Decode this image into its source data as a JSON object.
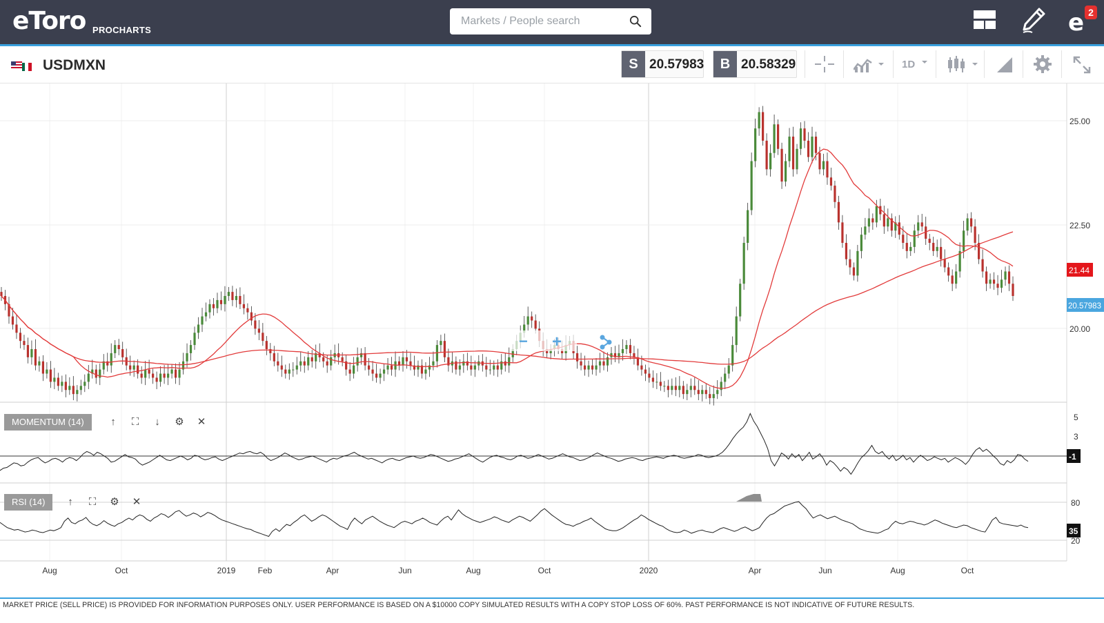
{
  "header": {
    "logo": "eToro",
    "product": "PROCHARTS",
    "search_placeholder": "Markets / People search",
    "notifications_count": "2"
  },
  "instrument": {
    "symbol": "USDMXN",
    "sell_tag": "S",
    "sell_price": "20.57983",
    "buy_tag": "B",
    "buy_price": "20.58329",
    "timeframe": "1D"
  },
  "price_axis": {
    "ticks": [
      "25.00",
      "22.50",
      "20.00"
    ],
    "ma_label": "21.44",
    "price_label": "20.57983"
  },
  "zoom_tools": {
    "zoom_out": "−",
    "zoom_in": "+"
  },
  "momentum": {
    "label": "MOMENTUM (14)",
    "ticks": [
      "5",
      "3"
    ],
    "value_label": "-1",
    "series": [
      -1.9,
      -1.6,
      -1.5,
      -1.2,
      -0.9,
      -1.0,
      -1.3,
      -1.2,
      -0.8,
      -0.5,
      -0.3,
      -0.2,
      -0.6,
      -0.9,
      -0.7,
      -0.4,
      -0.3,
      -0.5,
      -0.8,
      -0.4,
      -0.2,
      -0.3,
      -0.6,
      -0.2,
      0.3,
      0.6,
      0.4,
      0.1,
      0.5,
      0.3,
      0.0,
      -0.3,
      -0.8,
      -0.7,
      -0.4,
      -0.1,
      0.2,
      -0.1,
      -0.2,
      -0.4,
      -0.9,
      -1.2,
      -1.0,
      -0.8,
      -0.5,
      -0.2,
      0.1,
      -0.2,
      -0.5,
      -0.6,
      -0.4,
      -0.2,
      0.0,
      -0.2,
      -0.5,
      -0.3,
      0.1,
      0.0,
      -0.3,
      -0.5,
      -0.4,
      -0.2,
      -0.1,
      -0.4,
      -0.6,
      -0.4,
      -0.2,
      0.0,
      0.2,
      0.4,
      0.3,
      0.5,
      0.6,
      0.4,
      0.3,
      0.5,
      0.2,
      -0.3,
      -0.6,
      -0.4,
      -0.2,
      0.1,
      0.4,
      0.2,
      -0.1,
      -0.3,
      -0.5,
      -0.4,
      -0.2,
      -0.1,
      0.0,
      -0.2,
      -0.4,
      -0.6,
      -0.8,
      -0.5,
      -0.3,
      -0.4,
      -0.2,
      0.0,
      0.1,
      0.3,
      0.5,
      0.2,
      0.0,
      -0.2,
      -0.4,
      -0.3,
      -0.5,
      -0.7,
      -0.9,
      -0.6,
      -0.4,
      -0.3,
      -0.5,
      -0.6,
      -0.4,
      -0.2,
      -0.1,
      0.0,
      -0.2,
      -0.3,
      -0.2,
      0.0,
      0.2,
      0.1,
      -0.1,
      -0.3,
      -0.5,
      -0.7,
      -0.6,
      -0.4,
      -0.3,
      -0.1,
      0.1,
      0.3,
      0.0,
      -0.3,
      -0.6,
      -0.8,
      -0.5,
      -0.2,
      0.0,
      0.1,
      -0.1,
      -0.2,
      -0.4,
      -0.5,
      -0.3,
      0.0,
      0.1,
      -0.1,
      -0.3,
      -0.2,
      0.0,
      0.2,
      0.0,
      -0.2,
      -0.4,
      -0.3,
      -0.1,
      0.1,
      0.3,
      0.1,
      -0.1,
      -0.2,
      -0.4,
      -0.6,
      -0.5,
      -0.3,
      -0.1,
      0.2,
      0.4,
      0.2,
      0.0,
      -0.2,
      -0.3,
      -0.5,
      -0.7,
      -0.6,
      -0.4,
      -0.3,
      -0.2,
      -0.3,
      -0.5,
      -0.6,
      -0.4,
      -0.3,
      -0.2,
      -0.1,
      -0.2,
      -0.3,
      -0.1,
      0.0,
      0.1,
      0.0,
      -0.2,
      -0.3,
      -0.2,
      -0.1,
      0.0,
      0.2,
      0.1,
      -0.1,
      -0.2,
      -0.1,
      0.0,
      0.2,
      0.5,
      1.0,
      1.6,
      2.3,
      2.9,
      3.4,
      3.8,
      4.5,
      5.6,
      4.6,
      3.9,
      3.0,
      2.1,
      1.0,
      -0.6,
      -1.3,
      -0.5,
      0.4,
      0.1,
      -0.4,
      0.3,
      -0.2,
      0.2,
      -0.6,
      -0.1,
      0.5,
      -0.4,
      -0.1,
      0.3,
      -0.3,
      -1.2,
      -0.6,
      -0.9,
      -1.4,
      -2.0,
      -1.5,
      -1.8,
      -2.4,
      -1.7,
      -0.9,
      -0.2,
      0.2,
      0.7,
      1.4,
      0.6,
      0.3,
      0.6,
      0.0,
      -0.4,
      0.1,
      -0.6,
      -0.3,
      0.1,
      -0.5,
      -0.2,
      -0.8,
      -0.3,
      0.1,
      -0.2,
      -0.6,
      -0.4,
      -0.1,
      -0.3,
      -0.5,
      -0.3,
      -0.8,
      -0.5,
      -0.2,
      -0.4,
      -0.7,
      -1.1,
      -0.6,
      0.2,
      0.8,
      1.1,
      0.6,
      0.9,
      0.5,
      0.0,
      -0.4,
      -1.0,
      -1.2,
      -0.6,
      -0.9,
      -0.5,
      0.2,
      0.1,
      -0.4,
      -0.7
    ]
  },
  "rsi": {
    "label": "RSI (14)",
    "ticks": [
      "80",
      "20"
    ],
    "value_label": "35",
    "series": [
      48,
      44,
      40,
      38,
      36,
      37,
      35,
      33,
      34,
      36,
      35,
      33,
      32,
      34,
      36,
      35,
      37,
      40,
      50,
      55,
      48,
      46,
      50,
      52,
      56,
      49,
      45,
      43,
      46,
      51,
      47,
      44,
      42,
      46,
      48,
      52,
      55,
      52,
      57,
      60,
      58,
      53,
      50,
      55,
      58,
      62,
      60,
      56,
      60,
      65,
      67,
      62,
      58,
      60,
      63,
      61,
      57,
      60,
      64,
      62,
      59,
      55,
      52,
      50,
      48,
      46,
      44,
      42,
      40,
      38,
      37,
      34,
      32,
      30,
      28,
      26,
      34,
      38,
      34,
      40,
      45,
      43,
      48,
      52,
      57,
      60,
      55,
      50,
      53,
      57,
      60,
      58,
      54,
      50,
      46,
      42,
      40,
      37,
      48,
      55,
      50,
      46,
      52,
      55,
      58,
      54,
      50,
      47,
      44,
      42,
      40,
      44,
      48,
      50,
      48,
      46,
      50,
      52,
      55,
      52,
      48,
      46,
      44,
      50,
      55,
      58,
      52,
      60,
      68,
      62,
      58,
      55,
      52,
      50,
      48,
      50,
      52,
      54,
      57,
      55,
      52,
      50,
      48,
      52,
      55,
      58,
      56,
      53,
      50,
      55,
      60,
      66,
      70,
      65,
      60,
      56,
      52,
      48,
      45,
      44,
      42,
      45,
      47,
      50,
      52,
      55,
      50,
      46,
      42,
      38,
      36,
      35,
      35,
      37,
      40,
      44,
      48,
      52,
      55,
      60,
      57,
      53,
      50,
      47,
      44,
      42,
      38,
      35,
      33,
      32,
      33,
      36,
      34,
      31,
      33,
      35,
      36,
      34,
      33,
      32,
      35,
      38,
      40,
      38,
      36,
      34,
      36,
      39,
      41,
      38,
      35,
      37,
      40,
      48,
      55,
      60,
      62,
      66,
      70,
      74,
      76,
      78,
      80,
      81,
      75,
      70,
      62,
      55,
      58,
      60,
      57,
      54,
      56,
      58,
      55,
      52,
      50,
      48,
      46,
      42,
      38,
      36,
      34,
      33,
      32,
      31,
      33,
      36,
      38,
      45,
      50,
      47,
      46,
      48,
      50,
      49,
      47,
      46,
      44,
      46,
      49,
      52,
      50,
      47,
      45,
      43,
      41,
      40,
      42,
      44,
      43,
      40,
      38,
      36,
      34,
      33,
      42,
      52,
      56,
      48,
      46,
      45,
      44,
      43,
      42,
      44,
      41,
      40
    ]
  },
  "time_axis": {
    "labels": [
      "Aug",
      "Oct",
      "2019",
      "Feb",
      "Apr",
      "Jun",
      "Aug",
      "Oct",
      "2020",
      "Apr",
      "Jun",
      "Aug",
      "Oct"
    ]
  },
  "price_chart": {
    "y_range": [
      18.1,
      25.9
    ],
    "candle_closes": [
      20.7,
      20.5,
      20.2,
      20.0,
      19.8,
      19.6,
      19.5,
      19.2,
      19.4,
      19.0,
      19.1,
      18.8,
      18.9,
      18.6,
      18.7,
      18.5,
      18.6,
      18.4,
      18.5,
      18.3,
      18.4,
      18.5,
      18.6,
      18.8,
      18.9,
      18.7,
      18.9,
      19.1,
      19.0,
      19.3,
      19.5,
      19.4,
      19.2,
      19.0,
      18.9,
      19.0,
      18.8,
      18.7,
      18.9,
      18.8,
      18.7,
      18.6,
      18.8,
      18.7,
      18.8,
      18.9,
      18.7,
      18.9,
      19.1,
      19.3,
      19.5,
      19.8,
      20.0,
      20.2,
      20.3,
      20.5,
      20.4,
      20.6,
      20.5,
      20.7,
      20.8,
      20.6,
      20.7,
      20.5,
      20.4,
      20.3,
      20.1,
      19.9,
      19.8,
      19.6,
      19.4,
      19.3,
      19.1,
      19.0,
      18.9,
      18.8,
      18.9,
      18.9,
      19.0,
      19.1,
      19.0,
      19.2,
      19.1,
      19.3,
      19.2,
      19.1,
      19.0,
      19.2,
      19.3,
      19.2,
      19.1,
      18.9,
      18.8,
      19.0,
      19.2,
      19.3,
      19.0,
      18.9,
      18.8,
      18.7,
      18.8,
      18.9,
      19.0,
      18.9,
      19.1,
      19.0,
      19.2,
      19.1,
      19.0,
      18.9,
      19.0,
      18.8,
      18.9,
      19.0,
      19.1,
      19.5,
      19.6,
      19.2,
      19.0,
      19.1,
      18.9,
      19.0,
      19.1,
      19.0,
      18.9,
      19.0,
      19.1,
      19.0,
      18.9,
      18.9,
      19.0,
      18.9,
      19.1,
      19.0,
      19.2,
      19.4,
      19.6,
      19.8,
      20.0,
      20.2,
      20.1,
      19.9,
      19.6,
      19.4,
      19.3,
      19.4,
      19.5,
      19.4,
      19.3,
      19.5,
      19.6,
      19.3,
      19.1,
      19.0,
      18.9,
      19.0,
      18.9,
      19.0,
      19.1,
      19.0,
      19.2,
      19.3,
      19.2,
      19.3,
      19.4,
      19.5,
      19.3,
      19.2,
      19.0,
      18.9,
      18.8,
      18.7,
      18.6,
      18.6,
      18.5,
      18.5,
      18.4,
      18.5,
      18.4,
      18.5,
      18.3,
      18.4,
      18.5,
      18.4,
      18.3,
      18.4,
      18.3,
      18.2,
      18.3,
      18.4,
      18.6,
      18.8,
      19.0,
      19.5,
      20.2,
      21.0,
      22.0,
      22.8,
      24.0,
      24.8,
      25.2,
      24.5,
      23.8,
      24.2,
      24.9,
      24.3,
      23.5,
      24.0,
      24.6,
      23.8,
      24.3,
      24.8,
      24.5,
      24.1,
      24.6,
      24.2,
      23.8,
      24.0,
      23.6,
      23.4,
      23.0,
      22.5,
      22.0,
      21.6,
      21.4,
      21.2,
      21.8,
      22.2,
      22.4,
      22.6,
      22.5,
      22.9,
      22.7,
      22.4,
      22.6,
      22.3,
      22.5,
      22.2,
      22.0,
      21.8,
      21.9,
      22.3,
      22.5,
      22.4,
      22.1,
      22.0,
      21.8,
      21.9,
      21.6,
      21.4,
      21.2,
      21.0,
      21.3,
      21.8,
      22.3,
      22.6,
      22.4,
      22.0,
      21.6,
      21.3,
      21.0,
      21.1,
      21.0,
      20.9,
      21.1,
      21.3,
      21.0,
      20.7
    ]
  }
}
